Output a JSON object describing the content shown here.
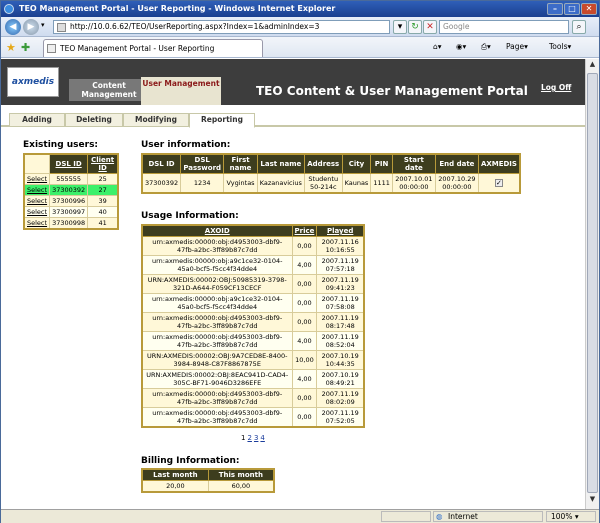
{
  "window": {
    "title": "TEO Management Portal - User Reporting - Windows Internet Explorer"
  },
  "address": {
    "url": "http://10.0.6.62/TEO/UserReporting.aspx?Index=1&adminIndex=3",
    "search_placeholder": "Google"
  },
  "browser_tab": {
    "label": "TEO Management Portal - User Reporting"
  },
  "toolbar": {
    "page_label": "Page",
    "tools_label": "Tools"
  },
  "banner": {
    "logo_text": "axmedis",
    "tab_content": "Content Management",
    "tab_user": "User Management",
    "title": "TEO Content & User Management Portal",
    "logoff": "Log Off"
  },
  "subtabs": [
    "Adding",
    "Deleting",
    "Modifying",
    "Reporting"
  ],
  "existing_users": {
    "title": "Existing users:",
    "headers": [
      "DSL ID",
      "Client ID"
    ],
    "select_label": "Select",
    "rows": [
      [
        "555555",
        "25"
      ],
      [
        "37300392",
        "27"
      ],
      [
        "37300996",
        "39"
      ],
      [
        "37300997",
        "40"
      ],
      [
        "37300998",
        "41"
      ]
    ]
  },
  "user_info": {
    "title": "User information:",
    "headers": [
      "DSL ID",
      "DSL Password",
      "First name",
      "Last name",
      "Address",
      "City",
      "PIN",
      "Start date",
      "End date",
      "AXMEDIS"
    ],
    "row": [
      "37300392",
      "1234",
      "Vygintas",
      "Kazanavicius",
      "Studentu 50-214c",
      "Kaunas",
      "1111",
      "2007.10.01 00:00:00",
      "2007.10.29 00:00:00"
    ]
  },
  "usage": {
    "title": "Usage Information:",
    "headers": [
      "AXOID",
      "Price",
      "Played"
    ],
    "rows": [
      [
        "urn:axmedis:00000:obj:d4953003-dbf9-47fb-a2bc-3ff89b87c7dd",
        "0,00",
        "2007.11.16 10:16:55"
      ],
      [
        "urn:axmedis:00000:obj:a9c1ce32-0104-45a0-bcf5-f5cc4f34dde4",
        "4,00",
        "2007.11.19 07:57:18"
      ],
      [
        "URN:AXMEDIS:00002:OBJ:50985319-3798-321D-A644-F059CF13CECF",
        "0,00",
        "2007.11.19 09:41:23"
      ],
      [
        "urn:axmedis:00000:obj:a9c1ce32-0104-45a0-bcf5-f5cc4f34dde4",
        "0,00",
        "2007.11.19 07:58:08"
      ],
      [
        "urn:axmedis:00000:obj:d4953003-dbf9-47fb-a2bc-3ff89b87c7dd",
        "0,00",
        "2007.11.19 08:17:48"
      ],
      [
        "urn:axmedis:00000:obj:d4953003-dbf9-47fb-a2bc-3ff89b87c7dd",
        "4,00",
        "2007.11.19 08:52:04"
      ],
      [
        "URN:AXMEDIS:00002:OBJ:9A7CED8E-8400-3984-8948-C87F8867875E",
        "10,00",
        "2007.10.19 10:44:35"
      ],
      [
        "URN:AXMEDIS:00002:OBJ:8EAC941D-CAD4-305C-BF71-9046D3286EFE",
        "4,00",
        "2007.10.19 08:49:21"
      ],
      [
        "urn:axmedis:00000:obj:d4953003-dbf9-47fb-a2bc-3ff89b87c7dd",
        "0,00",
        "2007.11.19 08:02:09"
      ],
      [
        "urn:axmedis:00000:obj:d4953003-dbf9-47fb-a2bc-3ff89b87c7dd",
        "0,00",
        "2007.11.19 07:52:05"
      ]
    ],
    "pager": [
      "1",
      "2",
      "3",
      "4"
    ]
  },
  "billing": {
    "title": "Billing Information:",
    "headers": [
      "Last month",
      "This month"
    ],
    "row": [
      "20,00",
      "60,00"
    ]
  },
  "status": {
    "zone": "Internet",
    "zoom": "100%"
  }
}
